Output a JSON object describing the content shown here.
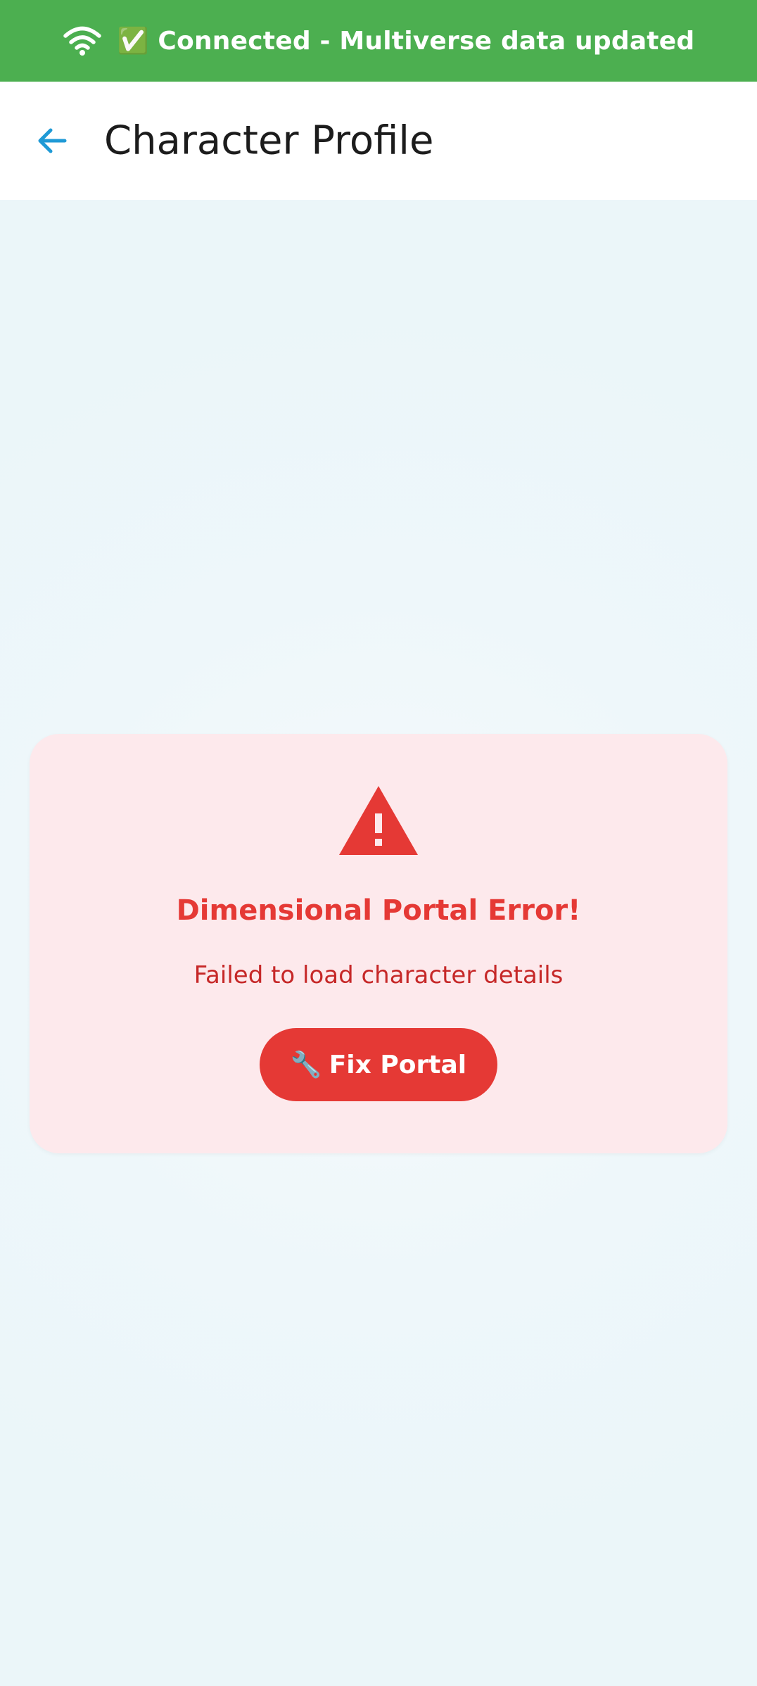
{
  "status_banner": {
    "icon": "wifi-icon",
    "text": "✅ Connected - Multiverse data updated",
    "background": "#4caf50"
  },
  "app_bar": {
    "back_icon": "arrow-left-icon",
    "title": "Character Profile",
    "accent": "#1f9ad6"
  },
  "error": {
    "icon": "warning-triangle-icon",
    "title": "Dimensional Portal Error!",
    "message": "Failed to load character details",
    "button_icon": "🔧",
    "button_label": "Fix Portal",
    "accent": "#e53935",
    "card_background": "#fde9ec"
  }
}
